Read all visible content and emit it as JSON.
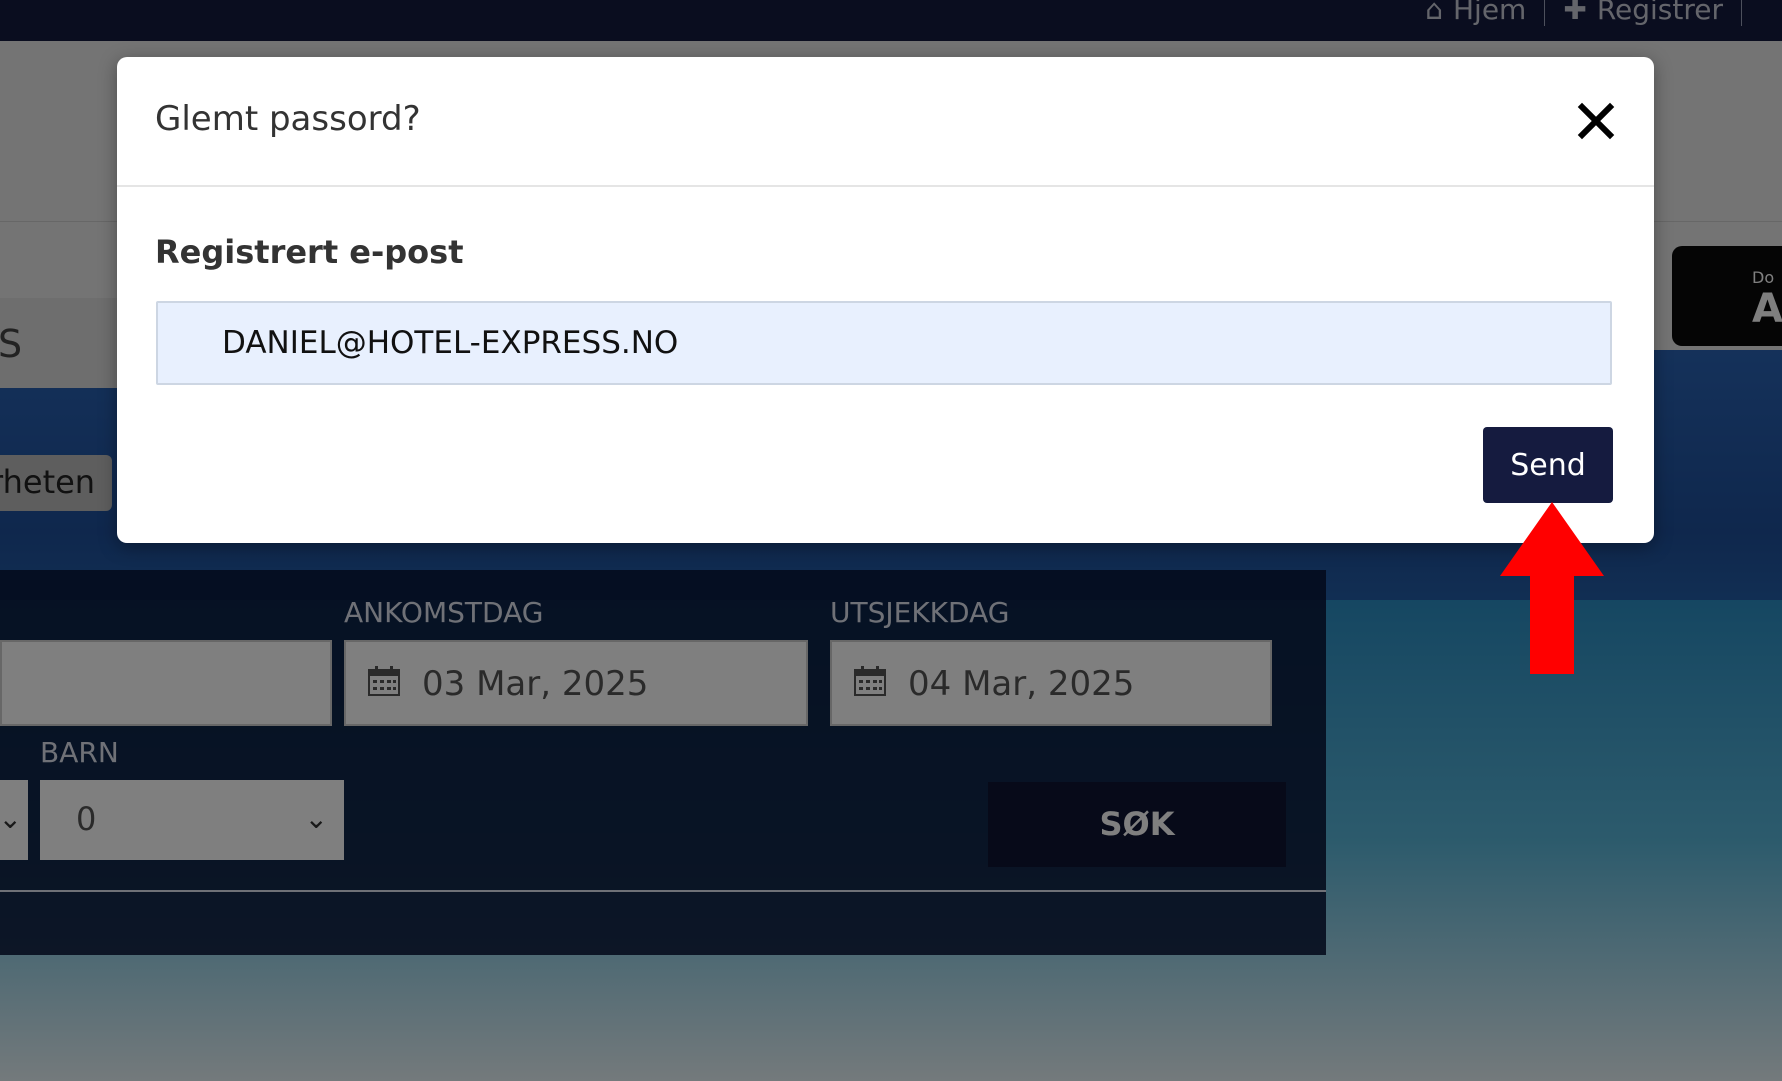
{
  "topnav": {
    "home_label": "Hjem",
    "register_label": "Registrer"
  },
  "background": {
    "tab_partial_text": "S",
    "tab_pill_partial_text": "rheten",
    "arrival_label": "ANKOMSTDAG",
    "arrival_value": "03 Mar, 2025",
    "checkout_label": "UTSJEKKDAG",
    "checkout_value": "04 Mar, 2025",
    "children_label": "BARN",
    "children_value": "0",
    "search_button": "SØK",
    "appstore_small": "Do",
    "appstore_big": "Ap"
  },
  "modal": {
    "title": "Glemt passord?",
    "email_label": "Registrert e-post",
    "email_value": "DANIEL@HOTEL-EXPRESS.NO",
    "send_label": "Send"
  },
  "colors": {
    "primary": "#151b3f",
    "annotation_arrow": "#ff0000",
    "input_autofill": "#e8f0fe"
  }
}
